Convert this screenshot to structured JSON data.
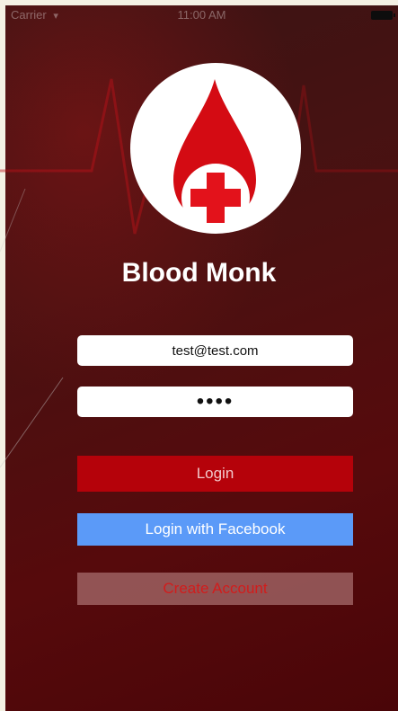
{
  "status_bar": {
    "carrier": "Carrier",
    "wifi_icon": "wifi-icon",
    "time": "11:00 AM",
    "battery_icon": "battery-icon"
  },
  "logo": {
    "icon": "blood-drop-cross-logo",
    "colors": {
      "drop": "#d40b13",
      "cross": "#e3121b",
      "circle": "#ffffff"
    }
  },
  "app": {
    "title": "Blood Monk"
  },
  "login_form": {
    "email_value": "test@test.com",
    "password_value": "••••",
    "login_label": "Login",
    "facebook_label": "Login with Facebook",
    "create_account_label": "Create Account"
  },
  "colors": {
    "background": "#4a1111",
    "login_button": "#b5020a",
    "facebook_button": "#5b9af8",
    "create_account_text": "#d21c1c"
  }
}
